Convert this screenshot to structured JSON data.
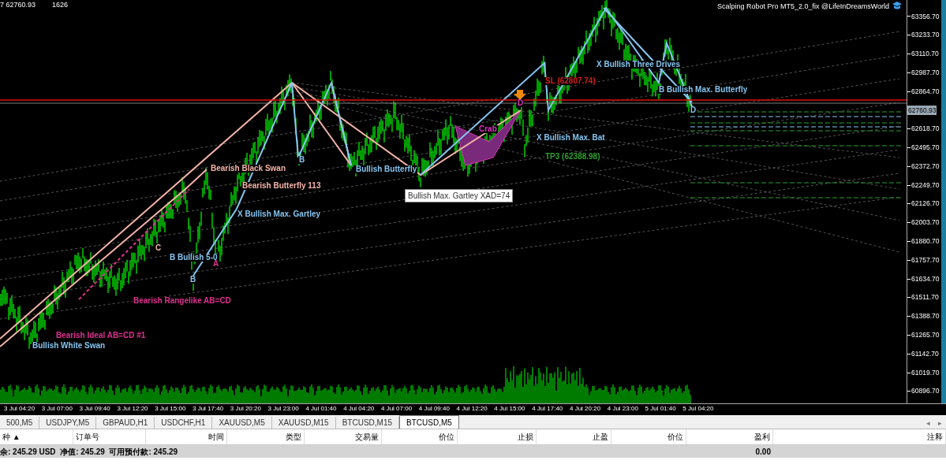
{
  "chart": {
    "quote": "7 62760.93",
    "count": "1626",
    "ea_name": "Scalping Robot Pro MT5_2.0_fix @LifeInDreamsWorld",
    "tooltip": "Bullish Max. Gartley XAD=74",
    "annotations": [
      {
        "text": "X Bullish Three Drives",
        "color": "#87c5f0"
      },
      {
        "text": "SL (62807.74)",
        "color": "#d02020"
      },
      {
        "text": "B Bullish Max. Butterfly",
        "color": "#87c5f0"
      },
      {
        "text": "D",
        "color": "#e030c0"
      },
      {
        "text": "D",
        "color": "#87c5f0"
      },
      {
        "text": "Crab",
        "color": "#e030c0"
      },
      {
        "text": "X Bullish Max. Bat",
        "color": "#87c5f0"
      },
      {
        "text": "B",
        "color": "#87c5f0"
      },
      {
        "text": "TP3 (62388.98)",
        "color": "#2e9e2e"
      },
      {
        "text": "Bearish Black Swan",
        "color": "#f4b4a8"
      },
      {
        "text": "Bullish Butterfly",
        "color": "#87c5f0"
      },
      {
        "text": "Bearish Butterfly 113",
        "color": "#f4b4a8"
      },
      {
        "text": "X Bullish Max. Gartley",
        "color": "#87c5f0"
      },
      {
        "text": "C",
        "color": "#f4b4a8"
      },
      {
        "text": "B Bullish 5-0",
        "color": "#87c5f0"
      },
      {
        "text": "A",
        "color": "#e0308f"
      },
      {
        "text": "B",
        "color": "#87c5f0"
      },
      {
        "text": "Bearish Rangelike AB=CD",
        "color": "#e0308f"
      },
      {
        "text": "Bearish Ideal AB=CD #1",
        "color": "#e0308f"
      },
      {
        "text": "Bullish White Swan",
        "color": "#87c5f0"
      }
    ]
  },
  "price_axis": [
    {
      "label": "63356.70",
      "kind": "tick"
    },
    {
      "label": "63233.70",
      "kind": "tick"
    },
    {
      "label": "63110.70",
      "kind": "tick"
    },
    {
      "label": "62987.70",
      "kind": "tick"
    },
    {
      "label": "62864.70",
      "kind": "tick"
    },
    {
      "label": "62760.93",
      "kind": "current"
    },
    {
      "label": "62618.70",
      "kind": "tick"
    },
    {
      "label": "62495.70",
      "kind": "tick"
    },
    {
      "label": "62372.70",
      "kind": "tick"
    },
    {
      "label": "62249.70",
      "kind": "tick"
    },
    {
      "label": "62126.70",
      "kind": "tick"
    },
    {
      "label": "62003.70",
      "kind": "tick"
    },
    {
      "label": "61880.70",
      "kind": "tick"
    },
    {
      "label": "61757.70",
      "kind": "tick"
    },
    {
      "label": "61634.70",
      "kind": "tick"
    },
    {
      "label": "61511.70",
      "kind": "tick"
    },
    {
      "label": "61388.70",
      "kind": "tick"
    },
    {
      "label": "61265.70",
      "kind": "tick"
    },
    {
      "label": "61142.70",
      "kind": "tick"
    },
    {
      "label": "61019.70",
      "kind": "tick"
    },
    {
      "label": "60896.70",
      "kind": "tick"
    }
  ],
  "time_axis": [
    "3 Jul 04:20",
    "3 Jul 07:00",
    "3 Jul 09:40",
    "3 Jul 12:20",
    "3 Jul 15:00",
    "3 Jul 17:40",
    "3 Jul 20:20",
    "3 Jul 23:00",
    "4 Jul 01:40",
    "4 Jul 04:20",
    "4 Jul 07:00",
    "4 Jul 09:40",
    "4 Jul 12:20",
    "4 Jul 15:00",
    "4 Jul 17:40",
    "4 Jul 20:20",
    "4 Jul 23:00",
    "5 Jul 01:40",
    "5 Jul 04:20"
  ],
  "tabs": [
    {
      "label": "500,M5",
      "selected": false
    },
    {
      "label": "USDJPY,M5",
      "selected": false
    },
    {
      "label": "GBPAUD,H1",
      "selected": false
    },
    {
      "label": "USDCHF,H1",
      "selected": false
    },
    {
      "label": "XAUUSD,M5",
      "selected": false
    },
    {
      "label": "XAUUSD,M15",
      "selected": false
    },
    {
      "label": "BTCUSD,M15",
      "selected": false
    },
    {
      "label": "BTCUSD,M5",
      "selected": true
    }
  ],
  "tab_scroll": [
    "◂",
    "▸"
  ],
  "table": {
    "columns": [
      "种 ▲",
      "订单号",
      "时间",
      "类型",
      "交易量",
      "价位",
      "止损",
      "止盈",
      "价位",
      "盈利",
      "注释"
    ],
    "summary": "余: 245.29 USD  净值: 245.29  可用预付款: 245.29",
    "profit": "0.00"
  }
}
